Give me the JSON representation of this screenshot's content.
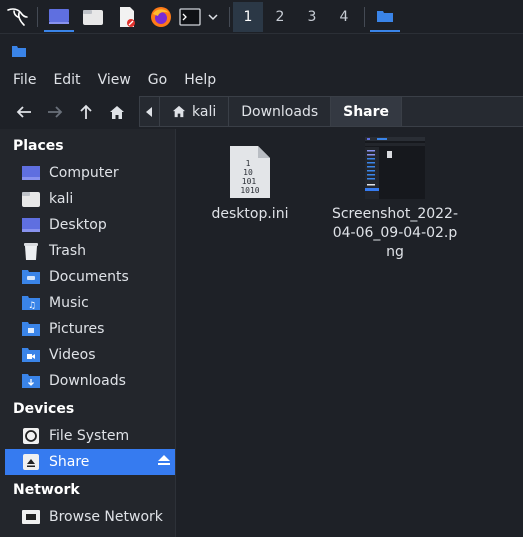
{
  "panel": {
    "workspaces": [
      "1",
      "2",
      "3",
      "4"
    ]
  },
  "menu": [
    "File",
    "Edit",
    "View",
    "Go",
    "Help"
  ],
  "path": {
    "crumbs": [
      "kali",
      "Downloads",
      "Share"
    ]
  },
  "sidebar": {
    "places_title": "Places",
    "places": [
      "Computer",
      "kali",
      "Desktop",
      "Trash",
      "Documents",
      "Music",
      "Pictures",
      "Videos",
      "Downloads"
    ],
    "devices_title": "Devices",
    "devices": [
      "File System",
      "Share"
    ],
    "network_title": "Network",
    "network": [
      "Browse Network"
    ]
  },
  "files": [
    {
      "name": "desktop.ini",
      "icon": "text-file-icon",
      "icon_text": [
        "1",
        "10",
        "101",
        "1010"
      ]
    },
    {
      "name": "Screenshot_2022-04-06_09-04-02.png",
      "icon": "image-thumbnail"
    }
  ],
  "colors": {
    "accent": "#367bf0",
    "folder": "#3a84e8",
    "background": "#1e2127"
  }
}
